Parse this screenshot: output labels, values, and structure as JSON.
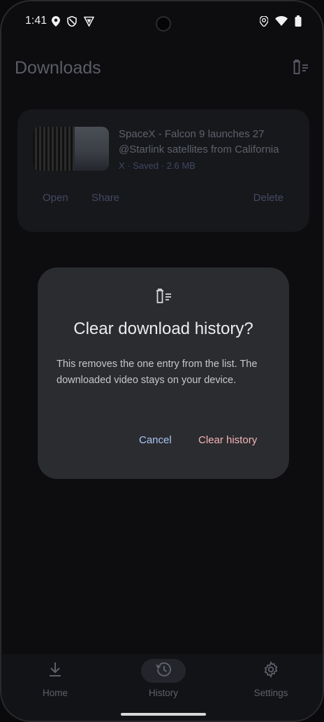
{
  "status_bar": {
    "time": "1:41",
    "left_icons": [
      "location-pin-icon",
      "shield-icon",
      "vpn-shield-icon"
    ],
    "right_icons": [
      "location-pin-icon",
      "wifi-icon",
      "battery-icon"
    ]
  },
  "app_bar": {
    "title": "Downloads",
    "action_icon": "clear-history-icon"
  },
  "download_item": {
    "title": "SpaceX - Falcon 9 launches 27 @Starlink satellites from California",
    "meta": "X · Saved · 2.6 MB",
    "actions": {
      "open": "Open",
      "share": "Share",
      "delete": "Delete"
    }
  },
  "dialog": {
    "icon": "clear-history-icon",
    "title": "Clear download history?",
    "body": "This removes the one entry from the list. The downloaded video stays on your device.",
    "cancel": "Cancel",
    "confirm": "Clear history"
  },
  "bottom_nav": {
    "items": [
      {
        "label": "Home",
        "icon": "download-icon"
      },
      {
        "label": "History",
        "icon": "history-icon",
        "selected": true
      },
      {
        "label": "Settings",
        "icon": "gear-icon"
      }
    ]
  },
  "colors": {
    "dialog_surface": "#2b2c30",
    "cancel_text": "#aac4f5",
    "confirm_text": "#f3b5b5",
    "background": "#0d0d10"
  }
}
